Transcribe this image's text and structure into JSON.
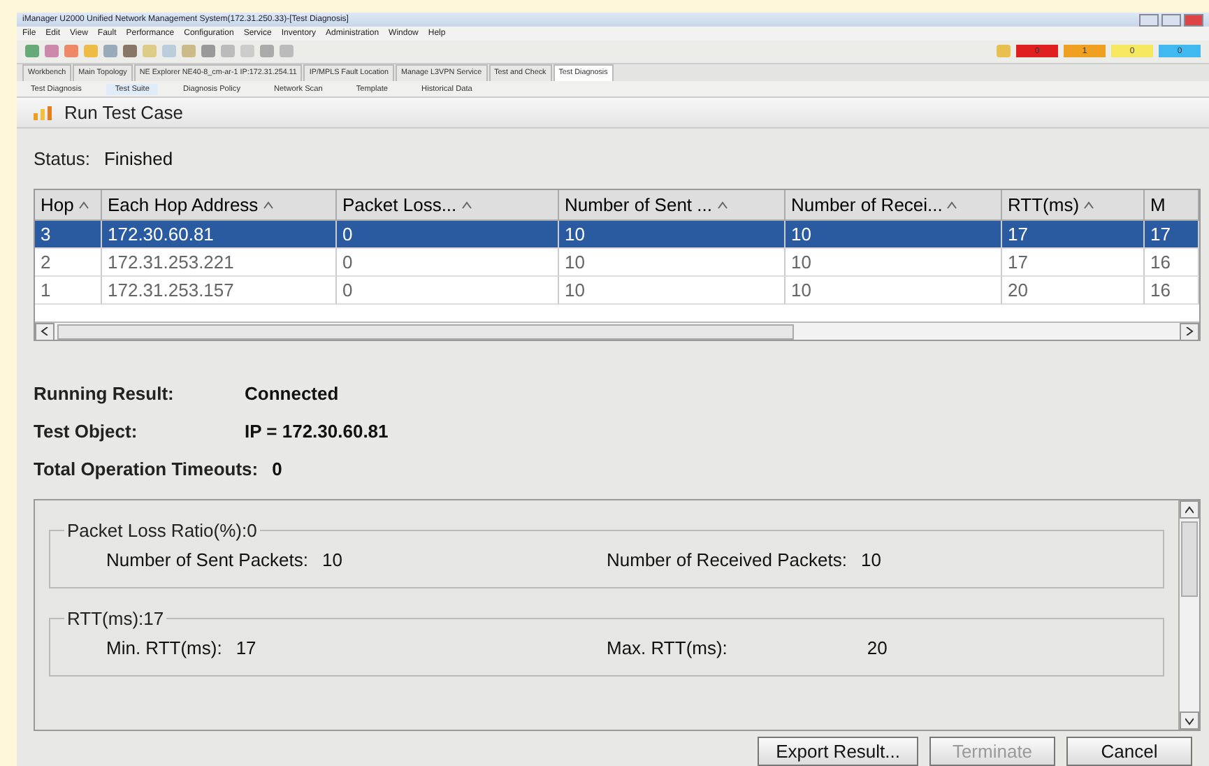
{
  "window": {
    "title": "iManager U2000 Unified Network Management System(172.31.250.33)-[Test Diagnosis]"
  },
  "menu": [
    "File",
    "Edit",
    "View",
    "Fault",
    "Performance",
    "Configuration",
    "Service",
    "Inventory",
    "Administration",
    "Window",
    "Help"
  ],
  "alarms": [
    {
      "count": "0",
      "color": "#e02020"
    },
    {
      "count": "1",
      "color": "#f0a020"
    },
    {
      "count": "0",
      "color": "#f5e860"
    },
    {
      "count": "0",
      "color": "#40b8f0"
    }
  ],
  "editor_tabs": [
    {
      "label": "Workbench",
      "selected": false
    },
    {
      "label": "Main Topology",
      "selected": false
    },
    {
      "label": "NE Explorer NE40-8_cm-ar-1 IP:172.31.254.11",
      "selected": false
    },
    {
      "label": "IP/MPLS Fault Location",
      "selected": false
    },
    {
      "label": "Manage L3VPN Service",
      "selected": false
    },
    {
      "label": "Test and Check",
      "selected": false
    },
    {
      "label": "Test Diagnosis",
      "selected": true
    }
  ],
  "sub_tabs": [
    {
      "label": "Test Diagnosis",
      "selected": false
    },
    {
      "label": "Test Suite",
      "selected": true
    },
    {
      "label": "Diagnosis Policy",
      "selected": false
    },
    {
      "label": "Network Scan",
      "selected": false
    },
    {
      "label": "Template",
      "selected": false
    },
    {
      "label": "Historical Data",
      "selected": false
    }
  ],
  "panel_title": "Run Test Case",
  "status": {
    "label": "Status:",
    "value": "Finished"
  },
  "table": {
    "columns": [
      "Hop",
      "Each Hop Address",
      "Packet Loss...",
      "Number of Sent ...",
      "Number of Recei...",
      "RTT(ms)",
      "M"
    ],
    "rows": [
      {
        "cells": [
          "3",
          "172.30.60.81",
          "0",
          "10",
          "10",
          "17",
          "17"
        ],
        "selected": true
      },
      {
        "cells": [
          "2",
          "172.31.253.221",
          "0",
          "10",
          "10",
          "17",
          "16"
        ],
        "selected": false
      },
      {
        "cells": [
          "1",
          "172.31.253.157",
          "0",
          "10",
          "10",
          "20",
          "16"
        ],
        "selected": false
      }
    ]
  },
  "results": [
    {
      "label": "Running Result:",
      "value": "Connected"
    },
    {
      "label": "Test Object:",
      "value": "IP = 172.30.60.81"
    },
    {
      "label": "Total Operation Timeouts:",
      "value": "0"
    }
  ],
  "groups": [
    {
      "title": "Packet Loss Ratio(%):0",
      "fields": [
        {
          "label": "Number of Sent Packets:",
          "value": "10"
        },
        {
          "label": "Number of Received Packets:",
          "value": "10"
        }
      ]
    },
    {
      "title": "RTT(ms):17",
      "fields": [
        {
          "label": "Min. RTT(ms):",
          "value": "17"
        },
        {
          "label": "Max. RTT(ms):",
          "value": "20"
        }
      ]
    }
  ],
  "buttons": [
    {
      "label": "Export Result...",
      "disabled": false
    },
    {
      "label": "Terminate",
      "disabled": true
    },
    {
      "label": "Cancel",
      "disabled": false
    }
  ]
}
